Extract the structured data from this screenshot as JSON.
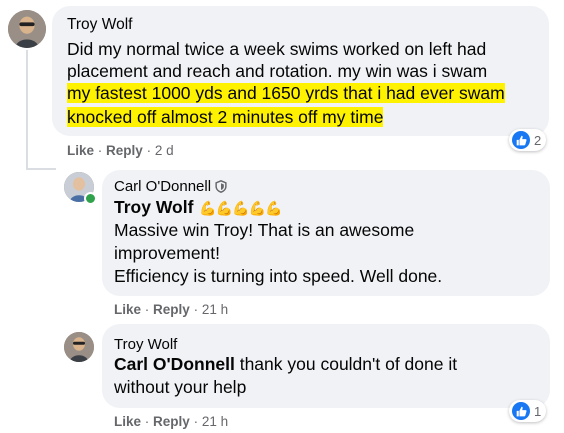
{
  "comments": [
    {
      "author": "Troy Wolf",
      "lines": [
        "Did my normal twice a week swims worked on left had",
        "placement and reach and rotation. my win was i swam"
      ],
      "highlight_lines": [
        "my fastest 1000 yds and 1650 yrds that i had ever swam",
        "knocked off almost 2 minutes off my time"
      ],
      "actions": {
        "like": "Like",
        "reply": "Reply",
        "time": "2 d"
      },
      "reaction_count": "2"
    },
    {
      "author": "Carl O'Donnell",
      "author_badge": "shield-badge-icon",
      "mention": "Troy Wolf",
      "mention_emoji": "💪💪💪💪💪",
      "lines": [
        "Massive win Troy! That is an awesome",
        "improvement!",
        "Efficiency is turning into speed. Well done."
      ],
      "actions": {
        "like": "Like",
        "reply": "Reply",
        "time": "21 h"
      }
    },
    {
      "author": "Troy Wolf",
      "mention": "Carl O'Donnell",
      "lines": [
        " thank you couldn't of done it",
        "without your help"
      ],
      "actions": {
        "like": "Like",
        "reply": "Reply",
        "time": "21 h"
      },
      "reaction_count": "1"
    }
  ],
  "separator": "·",
  "colors": {
    "highlight": "#fff200",
    "like_blue": "#1877f2",
    "bubble": "#f0f2f5",
    "meta": "#65676b"
  }
}
